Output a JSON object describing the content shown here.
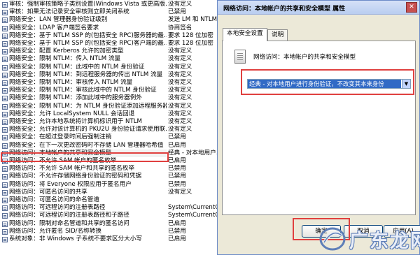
{
  "policies": [
    {
      "name": "审核：强制审核策略子类别设置(Windows Vista 或更高版…",
      "setting": "没有定义"
    },
    {
      "name": "审核：如果无法记录安全审核则立即关闭系统",
      "setting": "已禁用"
    },
    {
      "name": "网络安全：LAN 管理器身份验证级别",
      "setting": "发送 LM 和 NTLM - 如果…"
    },
    {
      "name": "网络安全：LDAP 客户端签名要求",
      "setting": "协商签名"
    },
    {
      "name": "网络安全：基于 NTLM SSP 的(包括安全 RPC)服务器的最…",
      "setting": "要求 128 位加密"
    },
    {
      "name": "网络安全：基于 NTLM SSP 的(包括安全 RPC)客户端的最…",
      "setting": "要求 128 位加密"
    },
    {
      "name": "网络安全：配置 Kerberos 允许的加密类型",
      "setting": "没有定义"
    },
    {
      "name": "网络安全：限制 NTLM：传入 NTLM 流量",
      "setting": "没有定义"
    },
    {
      "name": "网络安全：限制 NTLM：此域中的 NTLM 身份验证",
      "setting": "没有定义"
    },
    {
      "name": "网络安全：限制 NTLM：到远程服务器的传出 NTLM 流量",
      "setting": "没有定义"
    },
    {
      "name": "网络安全：限制 NTLM：审核传入 NTLM 流量",
      "setting": "没有定义"
    },
    {
      "name": "网络安全：限制 NTLM：审核此域中的 NTLM 身份验证",
      "setting": "没有定义"
    },
    {
      "name": "网络安全：限制 NTLM：添加此域中的服务器例外",
      "setting": "没有定义"
    },
    {
      "name": "网络安全：限制 NTLM：为 NTLM 身份验证添加远程服务器…",
      "setting": "没有定义"
    },
    {
      "name": "网络安全：允许 LocalSystem NULL 会话回退",
      "setting": "没有定义"
    },
    {
      "name": "网络安全：允许本地系统将计算机标识用于 NTLM",
      "setting": "没有定义"
    },
    {
      "name": "网络安全：允许对该计算机的 PKU2U 身份验证请求使用联…",
      "setting": "没有定义"
    },
    {
      "name": "网络安全：在超过登录时间后强制注销",
      "setting": "已禁用"
    },
    {
      "name": "网络安全：在下一次更改密码时不存储 LAN 管理器哈希值",
      "setting": "已启用"
    },
    {
      "name": "网络访问：本地帐户的共享和安全模型",
      "setting": "经典 - 对本地用户…"
    },
    {
      "name": "网络访问：不允许 SAM 帐户的匿名枚举",
      "setting": "已启用"
    },
    {
      "name": "网络访问：不允许 SAM 帐户和共享的匿名枚举",
      "setting": "已禁用"
    },
    {
      "name": "网络访问：不允许存储网络身份验证的密码和凭据",
      "setting": "已禁用"
    },
    {
      "name": "网络访问：将 Everyone 权限应用于匿名用户",
      "setting": "已禁用"
    },
    {
      "name": "网络访问：可匿名访问的共享",
      "setting": "没有定义"
    },
    {
      "name": "网络访问：可匿名访问的命名管道",
      "setting": ""
    },
    {
      "name": "网络访问：可远程访问的注册表路径",
      "setting": "System\\CurrentContr…"
    },
    {
      "name": "网络访问：可远程访问的注册表路径和子路径",
      "setting": "System\\CurrentContr…"
    },
    {
      "name": "网络访问：限制对命名管道和共享的匿名访问",
      "setting": "已启用"
    },
    {
      "name": "网络访问：允许匿名 SID/名称转换",
      "setting": "已禁用"
    },
    {
      "name": "系统对象：非 Windows 子系统不要求区分大小写",
      "setting": "已启用"
    }
  ],
  "dialog": {
    "title": "网络访问：本地帐户的共享和安全模型 属性",
    "close_glyph": "✕",
    "tabs": [
      "本地安全设置",
      "说明"
    ],
    "heading": "网络访问：本地帐户的共享和安全模型",
    "dropdown_value": "经典 - 对本地用户进行身份验证，不改变其本来身份",
    "dropdown_arrow": "▼",
    "buttons": {
      "ok": "确定",
      "cancel": "取消",
      "apply": "应用(A)"
    }
  },
  "watermark": {
    "text": "广东龙网"
  },
  "colors": {
    "highlight": "#e0403f",
    "dropdown_selected": "#316ac5",
    "dialog_bg": "#ece9d8"
  },
  "icons": [
    "policy-item-icon",
    "policy-document-icon",
    "dropdown-arrow-icon",
    "close-icon",
    "watermark-logo-icon"
  ]
}
